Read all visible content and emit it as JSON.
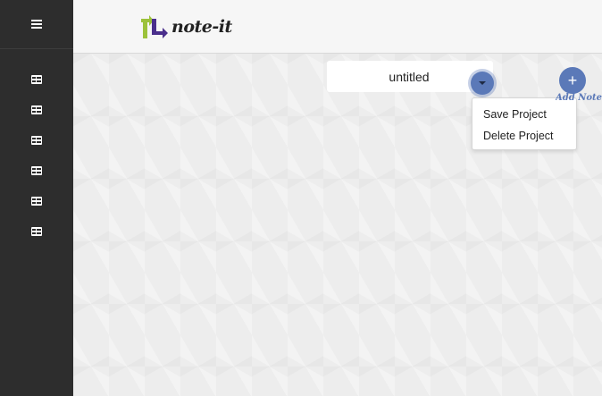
{
  "app": {
    "logo_text": "note-it"
  },
  "sidebar": {
    "menu_icon": "hamburger-icon",
    "items": [
      {
        "icon": "table-icon"
      },
      {
        "icon": "table-icon"
      },
      {
        "icon": "table-icon"
      },
      {
        "icon": "table-icon"
      },
      {
        "icon": "table-icon"
      },
      {
        "icon": "table-icon"
      }
    ]
  },
  "project": {
    "name": "untitled",
    "dropdown_icon": "caret-down-icon",
    "menu": [
      {
        "label": "Save Project"
      },
      {
        "label": "Delete Project"
      }
    ]
  },
  "add_note": {
    "icon_glyph": "+",
    "label": "Add Note"
  },
  "colors": {
    "sidebar_bg": "#2d2d2d",
    "header_bg": "#f6f6f6",
    "canvas_bg": "#ededed",
    "accent": "#5b79b8",
    "logo_green": "#9cc23b",
    "logo_purple": "#4a2f8c"
  }
}
